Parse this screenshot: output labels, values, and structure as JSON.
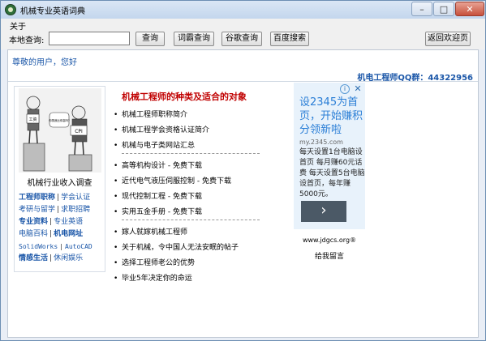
{
  "window": {
    "title": "机械专业英语词典",
    "controls": {
      "minimize": "–",
      "maximize": "□",
      "close": "✕"
    }
  },
  "menu": {
    "about": "关于"
  },
  "toolbar": {
    "label": "本地查询:",
    "search_value": "",
    "buttons": {
      "query": "查询",
      "ciba": "词霸查询",
      "google": "谷歌查询",
      "baidu": "百度搜索",
      "home": "返回欢迎页"
    }
  },
  "page": {
    "greeting": "尊敬的用户，您好",
    "qq_group": "机电工程师QQ群：44322956",
    "cartoon": {
      "caption": "机械行业收入调查",
      "labels": {
        "left_sign": "工资",
        "bubble": "你猜我比你高吗?",
        "right_sign": "CPI"
      }
    },
    "links": [
      [
        {
          "text": "工程师职称",
          "bold": true
        },
        {
          "text": "学会认证",
          "bold": false
        }
      ],
      [
        {
          "text": "考研与留学",
          "bold": false
        },
        {
          "text": "求职招聘",
          "bold": false
        }
      ],
      [
        {
          "text": "专业资料",
          "bold": true
        },
        {
          "text": "专业英语",
          "bold": false
        }
      ],
      [
        {
          "text": "电脑百科",
          "bold": false
        },
        {
          "text": "机电网址",
          "bold": true
        }
      ],
      [
        {
          "text": "SolidWorks",
          "bold": false
        },
        {
          "text": "AutoCAD",
          "bold": false
        }
      ],
      [
        {
          "text": "情感生活",
          "bold": true
        },
        {
          "text": "休闲娱乐",
          "bold": false
        }
      ]
    ],
    "section_title": "机械工程师的种类及适合的对象",
    "group1": [
      "机械工程师职称简介",
      "机械工程学会资格认证简介",
      "机械与电子类网站汇总"
    ],
    "group2": [
      "高等机构设计 - 免费下载",
      "近代电气液压伺服控制 - 免费下载",
      "现代控制工程 - 免费下载",
      "实用五金手册 - 免费下载"
    ],
    "group3": [
      "嫁人就嫁机械工程师",
      "关于机械，令中国人无法安眠的帖子",
      "选择工程师老公的优势",
      "毕业5年决定你的命运"
    ],
    "ad": {
      "headline": "设2345为首页，开始赚积分领新啦",
      "domain": "my.2345.com",
      "body": "每天设置1台电脑设首页 每月赚60元话费 每天设置5台电脑设首页，每年赚5000元。",
      "arrow": "›"
    },
    "site": {
      "url": "www.jdgcs.org®",
      "message": "给我留言"
    }
  },
  "colors": {
    "link": "#1a56a8",
    "title_red": "#c00000",
    "ad_blue": "#2a7ed6"
  }
}
